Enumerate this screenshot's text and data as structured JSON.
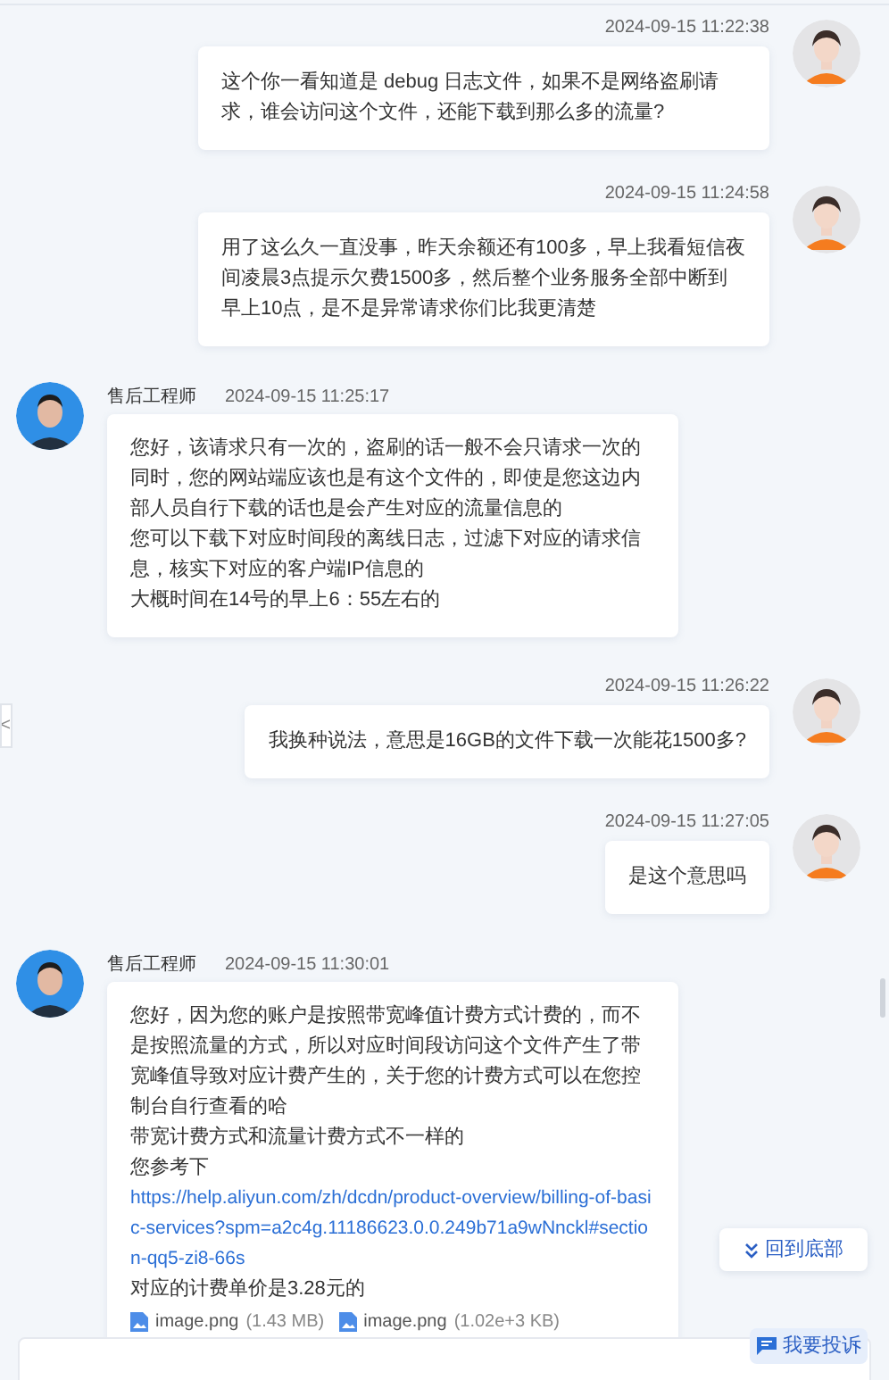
{
  "messages": [
    {
      "kind": "user",
      "time": "2024-09-15 11:22:38",
      "paragraphs": [
        {
          "kind": "text",
          "text": "这个你一看知道是 debug 日志文件，如果不是网络盗刷请求，谁会访问这个文件，还能下载到那么多的流量?"
        }
      ]
    },
    {
      "kind": "user",
      "time": "2024-09-15 11:24:58",
      "paragraphs": [
        {
          "kind": "text",
          "text": "用了这么久一直没事，昨天余额还有100多，早上我看短信夜间凌晨3点提示欠费1500多，然后整个业务服务全部中断到早上10点，是不是异常请求你们比我更清楚"
        }
      ]
    },
    {
      "kind": "agent",
      "sender": "售后工程师",
      "time": "2024-09-15 11:25:17",
      "paragraphs": [
        {
          "kind": "text",
          "text": "您好，该请求只有一次的，盗刷的话一般不会只请求一次的同时，您的网站端应该也是有这个文件的，即使是您这边内部人员自行下载的话也是会产生对应的流量信息的"
        },
        {
          "kind": "text",
          "text": "您可以下载下对应时间段的离线日志，过滤下对应的请求信息，核实下对应的客户端IP信息的"
        },
        {
          "kind": "text",
          "text": "大概时间在14号的早上6：55左右的"
        }
      ]
    },
    {
      "kind": "user",
      "time": "2024-09-15 11:26:22",
      "paragraphs": [
        {
          "kind": "text",
          "text": "我换种说法，意思是16GB的文件下载一次能花1500多?"
        }
      ]
    },
    {
      "kind": "user",
      "time": "2024-09-15 11:27:05",
      "paragraphs": [
        {
          "kind": "text",
          "text": "是这个意思吗"
        }
      ]
    },
    {
      "kind": "agent",
      "sender": "售后工程师",
      "time": "2024-09-15 11:30:01",
      "paragraphs": [
        {
          "kind": "text",
          "text": "您好，因为您的账户是按照带宽峰值计费方式计费的，而不是按照流量的方式，所以对应时间段访问这个文件产生了带宽峰值导致对应计费产生的，关于您的计费方式可以在您控制台自行查看的哈"
        },
        {
          "kind": "text",
          "text": "带宽计费方式和流量计费方式不一样的"
        },
        {
          "kind": "text",
          "text": "您参考下"
        },
        {
          "kind": "link",
          "text": "https://help.aliyun.com/zh/dcdn/product-overview/billing-of-basic-services?spm=a2c4g.11186623.0.0.249b71a9wNnckl#section-qq5-zi8-66s"
        },
        {
          "kind": "text",
          "text": "对应的计费单价是3.28元的"
        }
      ],
      "attachments": [
        {
          "name": "image.png",
          "size": "(1.43 MB)"
        },
        {
          "name": "image.png",
          "size": "(1.02e+3 KB)"
        }
      ]
    }
  ],
  "side_tab": {
    "glyph": "<"
  },
  "back_to_bottom": {
    "label": "回到底部"
  },
  "complaint": {
    "label": "我要投诉"
  }
}
